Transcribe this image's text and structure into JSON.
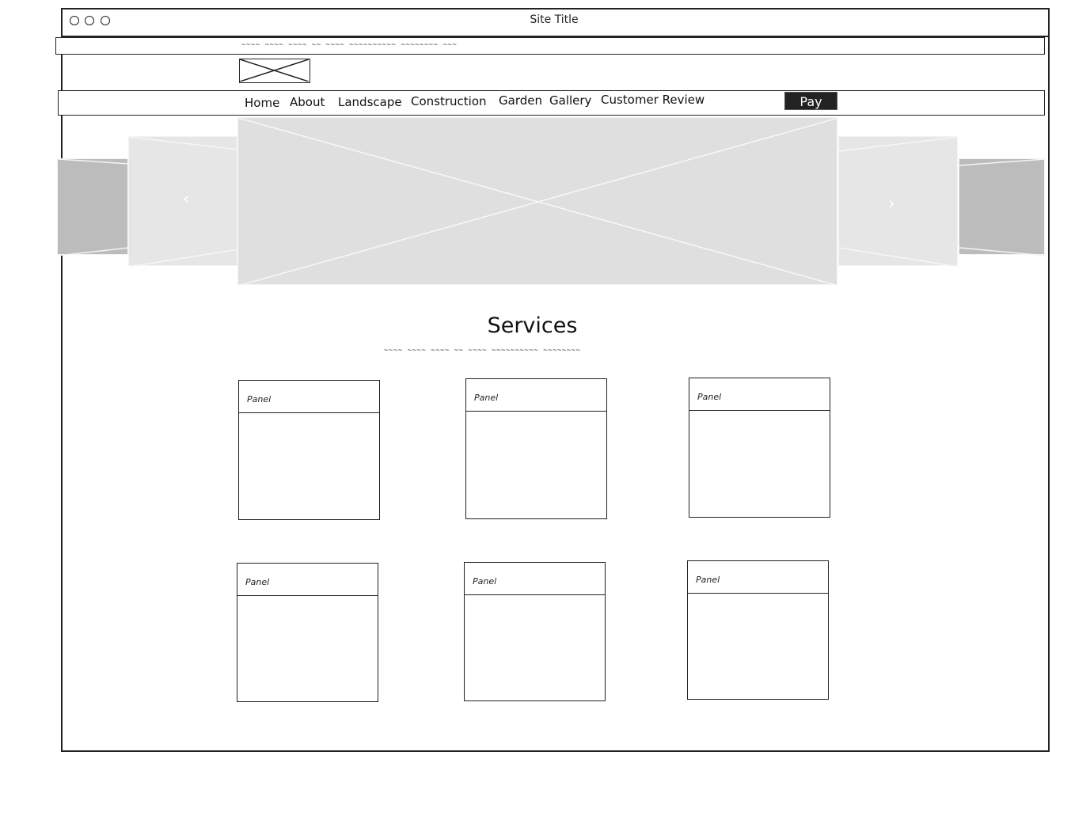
{
  "window": {
    "title": "Site Title",
    "controls": [
      "window-dot",
      "window-dot",
      "window-dot"
    ]
  },
  "infobar": {
    "text": "~~~~ ~~~~ ~~~~ ~~ ~~~~ ~~~~~~~~~~ ~~~~~~~~ ~~~"
  },
  "logo": {
    "icon": "image-placeholder-icon"
  },
  "nav": {
    "items": [
      {
        "label": "Home"
      },
      {
        "label": "About"
      },
      {
        "label": "Landscape"
      },
      {
        "label": "Construction"
      },
      {
        "label": "Garden"
      },
      {
        "label": "Gallery"
      },
      {
        "label": "Customer Review"
      }
    ],
    "pay_label": "Pay"
  },
  "carousel": {
    "prev_icon": "‹",
    "next_icon": "›",
    "colors": {
      "far": "#bcbcbc",
      "near": "#e6e6e6",
      "main": "#dfdfdf"
    }
  },
  "services": {
    "title": "Services",
    "subtitle": "~~~~ ~~~~ ~~~~ ~~ ~~~~ ~~~~~~~~~~ ~~~~~~~~",
    "panels": [
      {
        "label": "Panel"
      },
      {
        "label": "Panel"
      },
      {
        "label": "Panel"
      },
      {
        "label": "Panel"
      },
      {
        "label": "Panel"
      },
      {
        "label": "Panel"
      }
    ]
  }
}
